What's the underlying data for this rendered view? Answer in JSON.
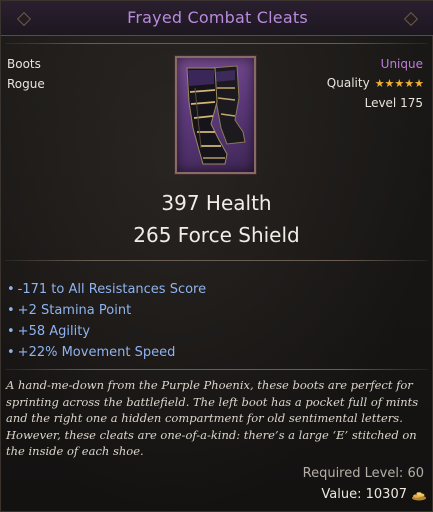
{
  "item": {
    "name": "Frayed Combat Cleats",
    "slot": "Boots",
    "class": "Rogue",
    "rarity": "Unique",
    "quality_label": "Quality",
    "quality_stars": "★★★★★",
    "level": "Level 175",
    "icon": "boots-icon"
  },
  "stats": {
    "health": "397 Health",
    "force_shield": "265 Force Shield"
  },
  "affixes": [
    "-171 to All Resistances Score",
    "+2 Stamina Point",
    "+58 Agility",
    "+22% Movement Speed"
  ],
  "flavor_text": "A hand-me-down from the Purple Phoenix, these boots are perfect for sprinting across the battlefield. The left boot has a pocket full of mints and the right one a hidden compartment for old sentimental letters. However, these cleats are one-of-a-kind: there’s a large ‘E’ stitched on the inside of each shoe.",
  "footer": {
    "required_level": "Required Level: 60",
    "value": "Value: 10307",
    "currency_icon": "gold-pile-icon"
  },
  "colors": {
    "title": "#b88bdd",
    "rarity": "#c07bdc",
    "affix": "#8fb3ee",
    "stars": "#f0b033"
  }
}
